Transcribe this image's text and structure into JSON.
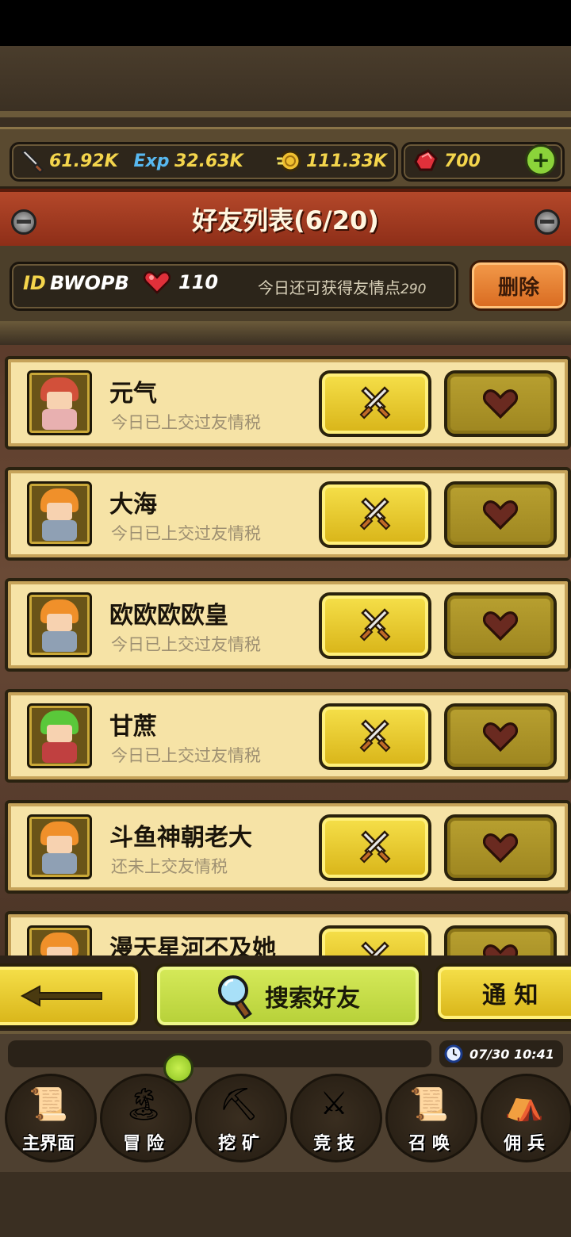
{
  "resources": {
    "attack": "61.92K",
    "exp_label": "Exp",
    "exp": "32.63K",
    "gold": "111.33K",
    "gems": "700"
  },
  "title": "好友列表(6/20)",
  "player": {
    "id_label": "ID",
    "id": "BWOPB",
    "hearts": "110",
    "daily_text": "今日还可获得友情点",
    "daily_points": "290",
    "delete_label": "删除"
  },
  "friends": [
    {
      "name": "元气",
      "status": "今日已上交过友情税",
      "hair": "#d2503a",
      "body": "#e8b0b0"
    },
    {
      "name": "大海",
      "status": "今日已上交过友情税",
      "hair": "#f0902a",
      "body": "#8fa0b4"
    },
    {
      "name": "欧欧欧欧皇",
      "status": "今日已上交过友情税",
      "hair": "#f0902a",
      "body": "#8fa0b4"
    },
    {
      "name": "甘蔗",
      "status": "今日已上交过友情税",
      "hair": "#5ac83a",
      "body": "#c04040"
    },
    {
      "name": "斗鱼神朝老大",
      "status": "还未上交友情税",
      "hair": "#f0902a",
      "body": "#8fa0b4"
    },
    {
      "name": "漫天星河不及她",
      "status": "",
      "hair": "#f0902a",
      "body": "#8fa0b4"
    }
  ],
  "buttons": {
    "search": "搜索好友",
    "notify": "通 知"
  },
  "clock": "07/30 10:41",
  "nav": [
    {
      "label": "主界面",
      "icon": "map-scroll-icon"
    },
    {
      "label": "冒 险",
      "icon": "island-icon"
    },
    {
      "label": "挖 矿",
      "icon": "pickaxe-icon"
    },
    {
      "label": "竞 技",
      "icon": "crossed-swords-icon"
    },
    {
      "label": "召 唤",
      "icon": "summon-scroll-icon"
    },
    {
      "label": "佣 兵",
      "icon": "tent-icon"
    }
  ]
}
